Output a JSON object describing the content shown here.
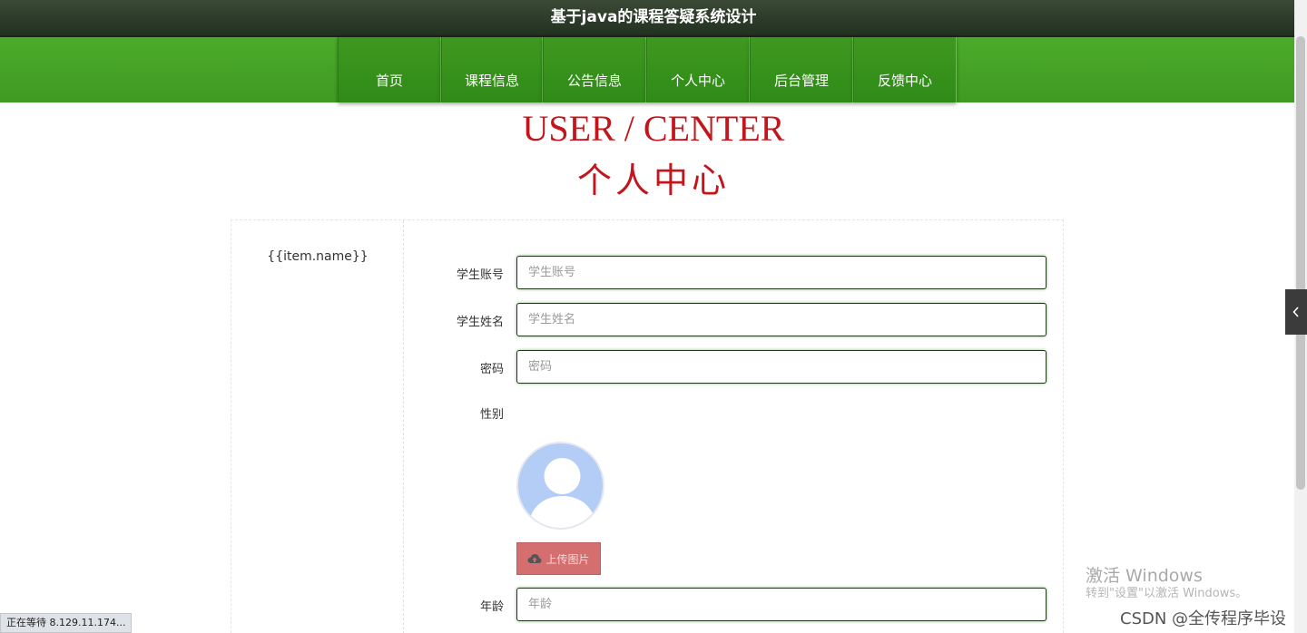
{
  "site": {
    "title": "基于java的课程答疑系统设计"
  },
  "nav": {
    "items": [
      {
        "label": "首页"
      },
      {
        "label": "课程信息"
      },
      {
        "label": "公告信息"
      },
      {
        "label": "个人中心"
      },
      {
        "label": "后台管理"
      },
      {
        "label": "反馈中心"
      }
    ]
  },
  "heading": {
    "en": "USER / CENTER",
    "cn": "个人中心"
  },
  "sidebar": {
    "item": "{{item.name}}"
  },
  "form": {
    "account": {
      "label": "学生账号",
      "placeholder": "学生账号"
    },
    "name": {
      "label": "学生姓名",
      "placeholder": "学生姓名"
    },
    "password": {
      "label": "密码",
      "placeholder": "密码"
    },
    "gender": {
      "label": "性别"
    },
    "upload_label": "上传图片",
    "age": {
      "label": "年龄",
      "placeholder": "年龄"
    }
  },
  "browser": {
    "status": "正在等待 8.129.11.174..."
  },
  "watermark": {
    "title": "激活 Windows",
    "subtitle": "转到\"设置\"以激活 Windows。",
    "csdn": "CSDN @全传程序毕设"
  },
  "colors": {
    "nav_green": "#45a326",
    "heading_red": "#c4151c",
    "upload_button": "#d56e6e",
    "avatar": "#b3cdf6"
  }
}
